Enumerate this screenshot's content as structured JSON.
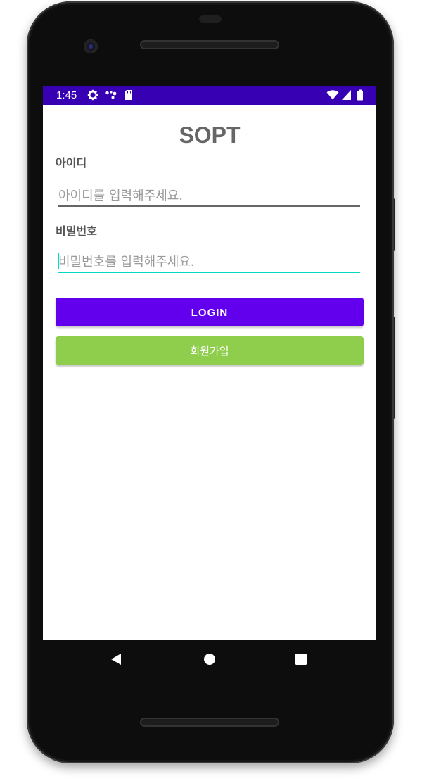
{
  "status_bar": {
    "time": "1:45",
    "background_color": "#3700b3",
    "icons": [
      "gear-icon",
      "assistant-dots-icon",
      "sd-card-icon",
      "wifi-icon",
      "signal-icon",
      "battery-icon"
    ]
  },
  "app": {
    "title": "SOPT"
  },
  "login_form": {
    "id_label": "아이디",
    "id_placeholder": "아이디를 입력해주세요.",
    "id_value": "",
    "password_label": "비밀번호",
    "password_placeholder": "비밀번호를 입력해주세요.",
    "password_value": "",
    "focused_field": "password",
    "focus_color": "#03dac5",
    "underline_color": "#666666"
  },
  "buttons": {
    "login_label": "LOGIN",
    "login_color": "#6200ee",
    "signup_label": "회원가입",
    "signup_color": "#8fce4c"
  },
  "nav_bar": {
    "icons": [
      "back-icon",
      "home-icon",
      "recents-icon"
    ]
  }
}
